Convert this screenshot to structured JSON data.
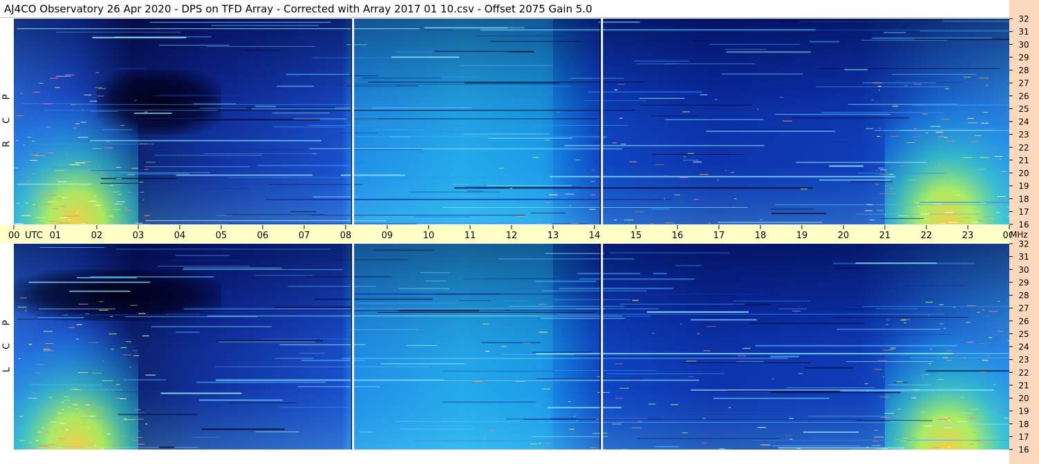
{
  "title": "AJ4CO Observatory  26 Apr 2020  -  DPS on TFD Array  -  Corrected with Array 2017 01 10.csv  -  Offset 2075  Gain 5.0",
  "side_labels": {
    "rcp": [
      "R",
      "C",
      "P"
    ],
    "lcp": [
      "L",
      "C",
      "P"
    ]
  },
  "colors": {
    "utc_bar": "#ffffc8",
    "freq_bar": "#fcd9bd",
    "spectrum_low": "#000018",
    "spectrum_mid": "#2060d8",
    "spectrum_high": "#ffff40"
  },
  "chart_data": {
    "type": "heatmap",
    "xlabel": "UTC",
    "ylabel": "MHz",
    "x_ticks": [
      "00",
      "01",
      "02",
      "03",
      "04",
      "05",
      "06",
      "07",
      "08",
      "09",
      "10",
      "11",
      "12",
      "13",
      "14",
      "15",
      "16",
      "17",
      "18",
      "19",
      "20",
      "21",
      "22",
      "23",
      "00"
    ],
    "xlim": [
      0,
      24
    ],
    "ylim": [
      16,
      32
    ],
    "y_ticks": [
      16,
      17,
      18,
      19,
      20,
      21,
      22,
      23,
      24,
      25,
      26,
      27,
      28,
      29,
      30,
      31,
      32
    ],
    "y_ticks_lcp": [
      16,
      17,
      18,
      19,
      20,
      21,
      22,
      23,
      24,
      25,
      26,
      27,
      28,
      29,
      30,
      31,
      32
    ],
    "time_markers_utc": [
      8.17,
      14.17
    ],
    "panels": [
      {
        "name": "RCP",
        "bright_regions": [
          {
            "t_start": 0.0,
            "t_end": 3.0,
            "f_low": 16,
            "f_high": 27.5
          },
          {
            "t_start": 21.0,
            "t_end": 24.0,
            "f_low": 16,
            "f_high": 28.0
          },
          {
            "t_start": 8.2,
            "t_end": 13.0,
            "f_low": 16,
            "f_high": 32
          }
        ],
        "dark_regions": [
          {
            "t_start": 2.0,
            "t_end": 5.0,
            "f_low": 23,
            "f_high": 28
          }
        ]
      },
      {
        "name": "LCP",
        "bright_regions": [
          {
            "t_start": 0.0,
            "t_end": 3.0,
            "f_low": 16,
            "f_high": 27.5
          },
          {
            "t_start": 21.0,
            "t_end": 24.0,
            "f_low": 16,
            "f_high": 27.5
          },
          {
            "t_start": 8.2,
            "t_end": 13.0,
            "f_low": 16,
            "f_high": 32
          }
        ],
        "dark_regions": [
          {
            "t_start": 0.0,
            "t_end": 5.0,
            "f_low": 26,
            "f_high": 30
          }
        ]
      }
    ]
  }
}
